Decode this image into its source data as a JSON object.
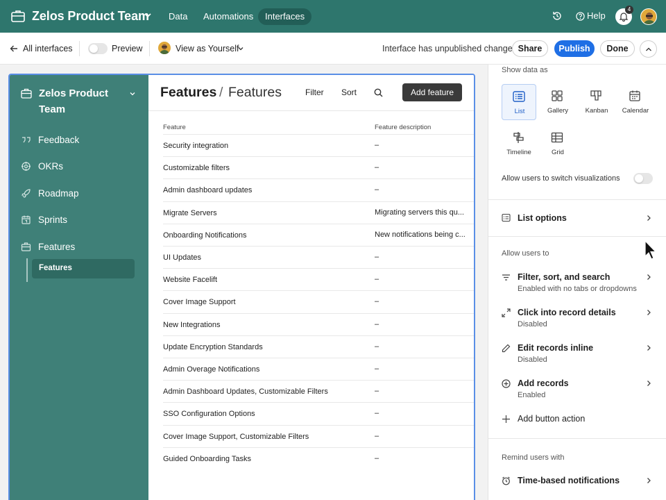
{
  "app": {
    "base_title": "Zelos Product Team",
    "nav": [
      "Data",
      "Automations",
      "Interfaces"
    ],
    "help": "Help",
    "notification_count": "4"
  },
  "toolbar": {
    "back": "All interfaces",
    "preview": "Preview",
    "view_as": "View as Yourself",
    "status": "Interface has unpublished changes",
    "share": "Share",
    "publish": "Publish",
    "done": "Done"
  },
  "sidebar": {
    "title": "Zelos Product Team",
    "items": [
      {
        "label": "Feedback",
        "icon": "quote-icon"
      },
      {
        "label": "OKRs",
        "icon": "target-icon"
      },
      {
        "label": "Roadmap",
        "icon": "rocket-icon"
      },
      {
        "label": "Sprints",
        "icon": "calendar-icon"
      },
      {
        "label": "Features",
        "icon": "briefcase-icon"
      }
    ],
    "sub_item": "Features"
  },
  "main": {
    "title": "Features",
    "separator": "/",
    "subtitle": "Features",
    "filter": "Filter",
    "sort": "Sort",
    "add": "Add feature",
    "columns": [
      "Feature",
      "Feature description"
    ],
    "rows": [
      [
        "Security integration",
        "–"
      ],
      [
        "Customizable filters",
        "–"
      ],
      [
        "Admin dashboard updates",
        "–"
      ],
      [
        "Migrate Servers",
        "Migrating servers this qu..."
      ],
      [
        "Onboarding Notifications",
        "New notifications being c..."
      ],
      [
        "UI Updates",
        "–"
      ],
      [
        "Website Facelift",
        "–"
      ],
      [
        "Cover Image Support",
        "–"
      ],
      [
        "New Integrations",
        "–"
      ],
      [
        "Update Encryption Standards",
        "–"
      ],
      [
        "Admin Overage Notifications",
        "–"
      ],
      [
        "Admin Dashboard Updates, Customizable Filters",
        "–"
      ],
      [
        "SSO Configuration Options",
        "–"
      ],
      [
        "Cover Image Support, Customizable Filters",
        "–"
      ],
      [
        "Guided Onboarding Tasks",
        "–"
      ]
    ]
  },
  "panel": {
    "show_data_as": "Show data as",
    "visualizations": [
      {
        "label": "List",
        "icon": "list-icon",
        "active": true
      },
      {
        "label": "Gallery",
        "icon": "gallery-icon",
        "active": false
      },
      {
        "label": "Kanban",
        "icon": "kanban-icon",
        "active": false
      },
      {
        "label": "Calendar",
        "icon": "calendar-icon",
        "active": false
      },
      {
        "label": "Timeline",
        "icon": "timeline-icon",
        "active": false
      },
      {
        "label": "Grid",
        "icon": "grid-icon",
        "active": false
      }
    ],
    "allow_switch": "Allow users to switch visualizations",
    "list_options": "List options",
    "allow_users_to": "Allow users to",
    "options": [
      {
        "title": "Filter, sort, and search",
        "sub": "Enabled with no tabs or dropdowns",
        "icon": "filter-icon"
      },
      {
        "title": "Click into record details",
        "sub": "Disabled",
        "icon": "expand-icon"
      },
      {
        "title": "Edit records inline",
        "sub": "Disabled",
        "icon": "pencil-icon"
      },
      {
        "title": "Add records",
        "sub": "Enabled",
        "icon": "plus-circle-icon"
      }
    ],
    "add_button_action": "Add button action",
    "remind_users_with": "Remind users with",
    "time_based": "Time-based notifications"
  },
  "colors": {
    "topbar": "#2e766d",
    "sidebar": "#3f8078",
    "primary": "#1f6fe5"
  }
}
